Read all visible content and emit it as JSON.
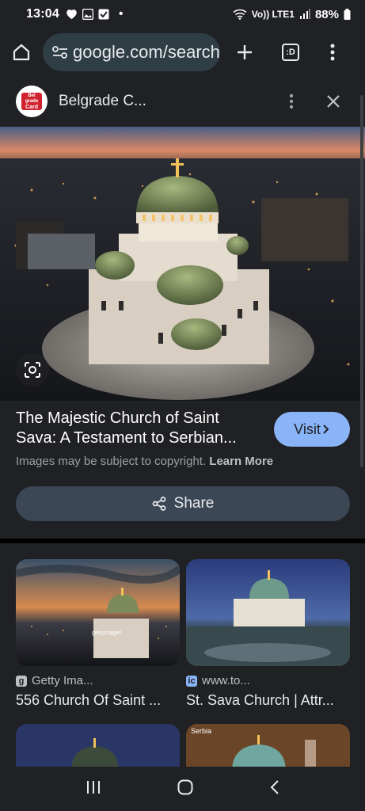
{
  "status": {
    "time": "13:04",
    "network": "Vo)) LTE1",
    "battery": "88%"
  },
  "browser": {
    "url": "google.com/search",
    "tab_count": ":D"
  },
  "viewer": {
    "site_name": "Belgrade C...",
    "logo_text": [
      "Bel",
      "grade",
      "Card"
    ],
    "title": "The Majestic Church of Saint Sava: A Testament to Serbian...",
    "visit_label": "Visit",
    "copyright_note": "Images may be subject to copyright.",
    "learn_more": "Learn More",
    "share_label": "Share"
  },
  "results": [
    {
      "source": "Getty Ima...",
      "favicon": "g",
      "title": "556 Church Of Saint ...",
      "watermark": "gettyimages"
    },
    {
      "source": "www.to...",
      "favicon": "ic",
      "title": "St. Sava Church | Attr..."
    },
    {
      "source": "",
      "title": ""
    },
    {
      "source": "Serbia",
      "title": ""
    }
  ],
  "icons": [
    "home-icon",
    "tune-icon",
    "plus-icon",
    "tabs-icon",
    "more-vert-icon",
    "close-icon",
    "lens-icon",
    "chevron-right-icon",
    "share-icon",
    "recents-icon",
    "home-circle-icon",
    "back-icon"
  ],
  "colors": {
    "accent": "#8ab4f8",
    "surface": "#202124",
    "share_bg": "#3c4755"
  }
}
